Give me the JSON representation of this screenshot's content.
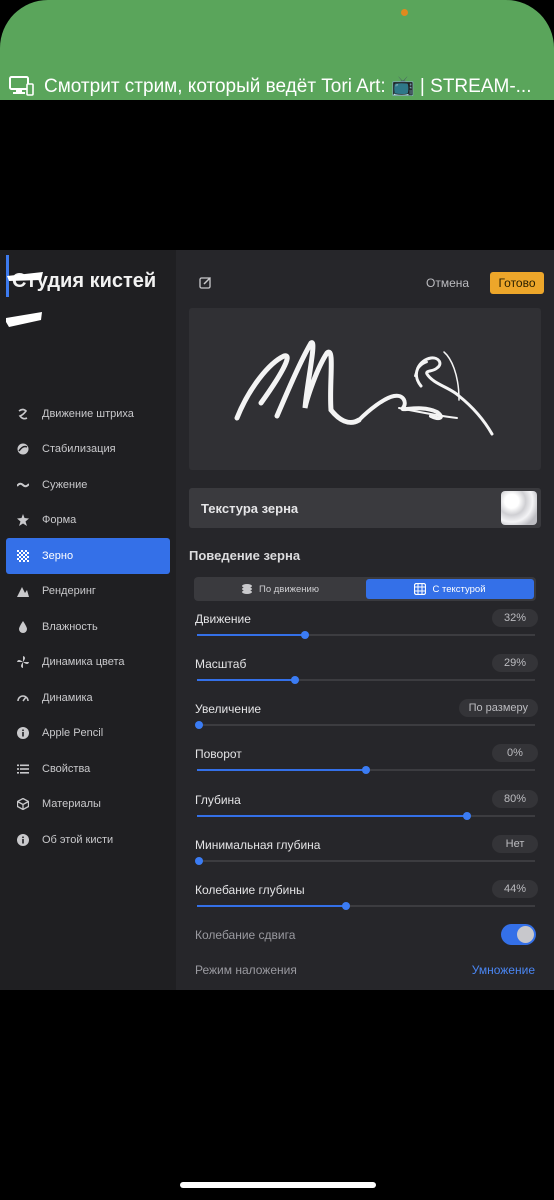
{
  "banner": {
    "text": "Смотрит стрим, который ведёт Tori Art: 📺  |  STREAM-..."
  },
  "app": {
    "title": "Студия кистей",
    "cancel_label": "Отмена",
    "done_label": "Готово"
  },
  "sidebar": {
    "items": [
      {
        "label": "Движение штриха",
        "icon": "stroke-path-icon"
      },
      {
        "label": "Стабилизация",
        "icon": "stabilization-icon"
      },
      {
        "label": "Сужение",
        "icon": "taper-icon"
      },
      {
        "label": "Форма",
        "icon": "shape-icon"
      },
      {
        "label": "Зерно",
        "icon": "grain-icon",
        "active": true
      },
      {
        "label": "Рендеринг",
        "icon": "rendering-icon"
      },
      {
        "label": "Влажность",
        "icon": "wet-mix-icon"
      },
      {
        "label": "Динамика цвета",
        "icon": "color-dynamics-icon"
      },
      {
        "label": "Динамика",
        "icon": "dynamics-icon"
      },
      {
        "label": "Apple Pencil",
        "icon": "info-icon"
      },
      {
        "label": "Свойства",
        "icon": "list-icon"
      },
      {
        "label": "Материалы",
        "icon": "cube-icon"
      },
      {
        "label": "Об этой кисти",
        "icon": "info-icon"
      }
    ]
  },
  "texture": {
    "label": "Текстура зерна"
  },
  "grain": {
    "section_title": "Поведение зерна",
    "mode_moving": "По движению",
    "mode_textured": "С текстурой",
    "params": [
      {
        "label": "Движение",
        "value": "32%",
        "level": 0.32
      },
      {
        "label": "Масштаб",
        "value": "29%",
        "level": 0.29
      },
      {
        "label": "Увеличение",
        "value": "По размеру",
        "level": 0.0
      },
      {
        "label": "Поворот",
        "value": "0%",
        "level": 0.5
      },
      {
        "label": "Глубина",
        "value": "80%",
        "level": 0.8
      },
      {
        "label": "Минимальная глубина",
        "value": "Нет",
        "level": 0.0
      },
      {
        "label": "Колебание глубины",
        "value": "44%",
        "level": 0.44
      }
    ],
    "offset_jitter_label": "Колебание сдвига",
    "offset_jitter_on": true,
    "blend_mode_label": "Режим наложения",
    "blend_mode_value": "Умножение"
  },
  "colors": {
    "accent": "#3470e8",
    "done": "#eda62a",
    "banner": "#5aa55b"
  }
}
